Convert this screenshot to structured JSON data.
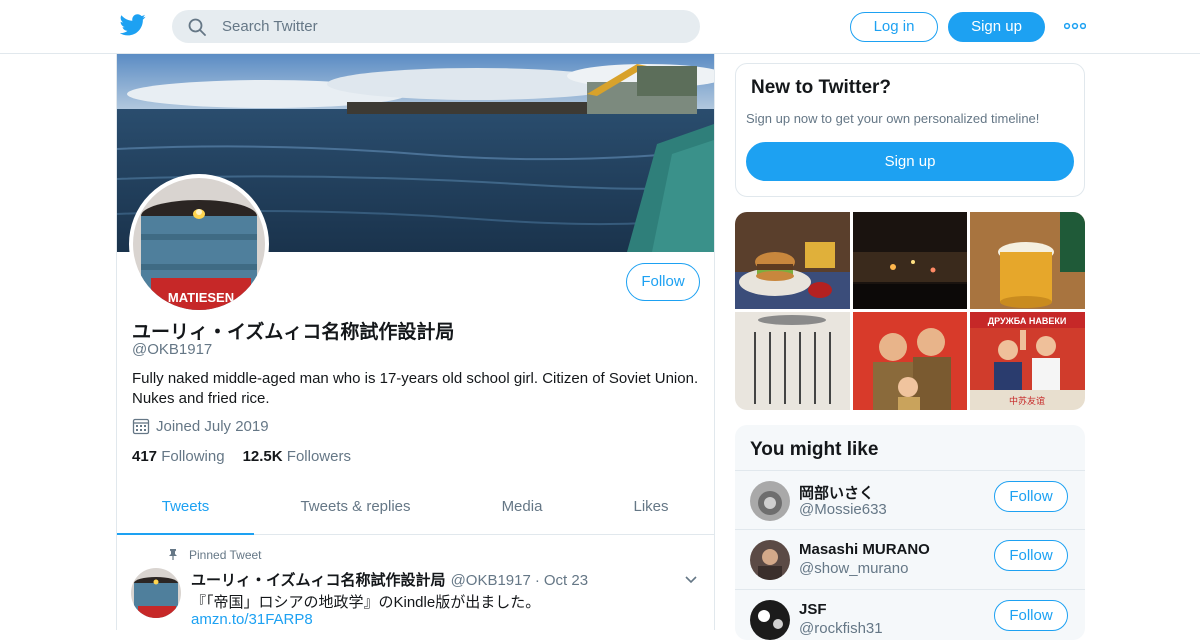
{
  "header": {
    "search_placeholder": "Search Twitter",
    "login_label": "Log in",
    "signup_label": "Sign up"
  },
  "profile": {
    "name": "ユーリィ・イズムィコ名称試作設計局",
    "handle": "@OKB1917",
    "bio": "Fully naked middle-aged man who is 17-years old school girl. Citizen of Soviet Union. Nukes and fried rice.",
    "joined": "Joined July 2019",
    "following_count": "417",
    "following_label": "Following",
    "followers_count": "12.5K",
    "followers_label": "Followers",
    "follow_label": "Follow",
    "avatar_text": "MATIESEN"
  },
  "tabs": [
    {
      "label": "Tweets",
      "active": true
    },
    {
      "label": "Tweets & replies",
      "active": false
    },
    {
      "label": "Media",
      "active": false
    },
    {
      "label": "Likes",
      "active": false
    }
  ],
  "pinned_tweet": {
    "pinned_label": "Pinned Tweet",
    "author_name": "ユーリィ・イズムィコ名称試作設計局",
    "author_handle": "@OKB1917",
    "separator": "·",
    "date": "Oct 23",
    "text": "『「帝国」ロシアの地政学』のKindle版が出ました。",
    "link": "amzn.to/31FARP8"
  },
  "new_to_twitter": {
    "title": "New to Twitter?",
    "subtitle": "Sign up now to get your own personalized timeline!",
    "signup_label": "Sign up"
  },
  "media_photos": {
    "poster_banner_text": "ДРУЖБА НАВЕКИ",
    "poster_caption_text": "中苏友谊"
  },
  "you_might_like": {
    "title": "You might like",
    "users": [
      {
        "name": "岡部いさく",
        "handle": "@Mossie633",
        "follow_label": "Follow"
      },
      {
        "name": "Masashi MURANO",
        "handle": "@show_murano",
        "follow_label": "Follow"
      },
      {
        "name": "JSF",
        "handle": "@rockfish31",
        "follow_label": "Follow"
      }
    ]
  },
  "colors": {
    "accent": "#1da1f2",
    "text_primary": "#14171a",
    "text_secondary": "#657786",
    "border": "#e1e8ed",
    "panel_bg": "#f5f8fa"
  }
}
